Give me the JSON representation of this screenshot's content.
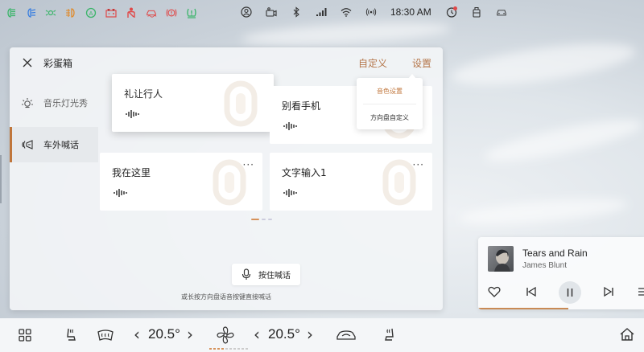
{
  "status_bar": {
    "indicators": [
      "headlight-icon",
      "low-beam-icon",
      "parking-light-icon",
      "fog-light-icon",
      "auto-hold-icon",
      "battery-warning-icon",
      "seatbelt-warning-icon",
      "traction-warning-icon",
      "brake-warning-icon",
      "tire-pressure-icon"
    ],
    "time": "18:30 AM"
  },
  "panel": {
    "title": "彩蛋箱",
    "custom_link": "自定义",
    "settings_link": "设置",
    "side_items": [
      {
        "label": "音乐灯光秀",
        "icon": "light-show-icon"
      },
      {
        "label": "车外喊话",
        "icon": "speaker-icon"
      }
    ],
    "cards": [
      {
        "title": "礼让行人"
      },
      {
        "title": "别看手机"
      },
      {
        "title": "我在这里"
      },
      {
        "title": "文字输入1"
      }
    ],
    "push_button": "按住喊话",
    "hint": "或长按方向盘语音按键直接喊话"
  },
  "dropdown": {
    "options": [
      "音色设置",
      "方向盘自定义"
    ]
  },
  "music": {
    "song": "Tears and Rain",
    "artist": "James Blunt",
    "progress": 0.55
  },
  "climate": {
    "left_temp": "20.5°",
    "right_temp": "20.5°"
  },
  "colors": {
    "accent": "#c0763b",
    "link": "#b5764a"
  }
}
